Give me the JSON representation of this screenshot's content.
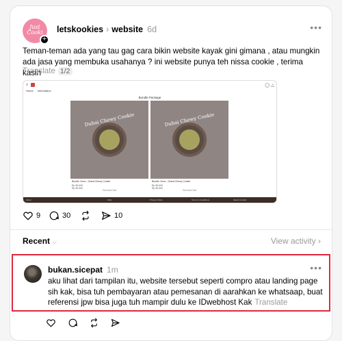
{
  "post": {
    "avatar_logo_text": "Just Cooki",
    "username": "letskookies",
    "community": "website",
    "time": "6d",
    "text": "Teman-teman ada yang tau gag cara bikin website kayak gini gimana , atau mungkin ada jasa yang membuka usahanya ? ini website punya teh nissa cookie , terima kasih",
    "translate_label": "Translate",
    "translate_page": "1/2",
    "likes": "9",
    "comments": "30",
    "shares": "10"
  },
  "embedded_site": {
    "nav_items": [
      "Home",
      "Information"
    ],
    "section_title": "Bundle Package",
    "products": [
      {
        "image_text": "Dubai Chewy Cookie",
        "name": "Bundle Jumo - Dubai Chewy Cookie",
        "price": "Rp 80,000",
        "price2": "Rp 60,000",
        "button": "Out Add Cart"
      },
      {
        "image_text": "Dubai Chewy Cookie",
        "name": "Bundle Jumo - Dubai Chewy Cookie",
        "price": "Rp 80,000",
        "price2": "Rp 60,000",
        "button": "Out Add Cart"
      }
    ],
    "footer_items": [
      "About",
      "FAQ",
      "Privacy Policy",
      "Terms & Conditions",
      "Select Contact"
    ]
  },
  "activity": {
    "recent_label": "Recent",
    "view_activity_label": "View activity"
  },
  "reply": {
    "username": "bukan.sicepat",
    "time": "1m",
    "text": "aku lihat dari tampilan itu, website tersebut seperti compro atau landing page sih kak, bisa tuh pembayaran atau pemesanan di aarahkan ke whatsaap, buat referensi jpw bisa juga tuh mampir dulu ke IDwebhost Kak",
    "translate_label": "Translate"
  },
  "colors": {
    "accent_red": "#e0263c",
    "avatar_pink": "#f28aa6",
    "footer_brown": "#3b2d24"
  }
}
